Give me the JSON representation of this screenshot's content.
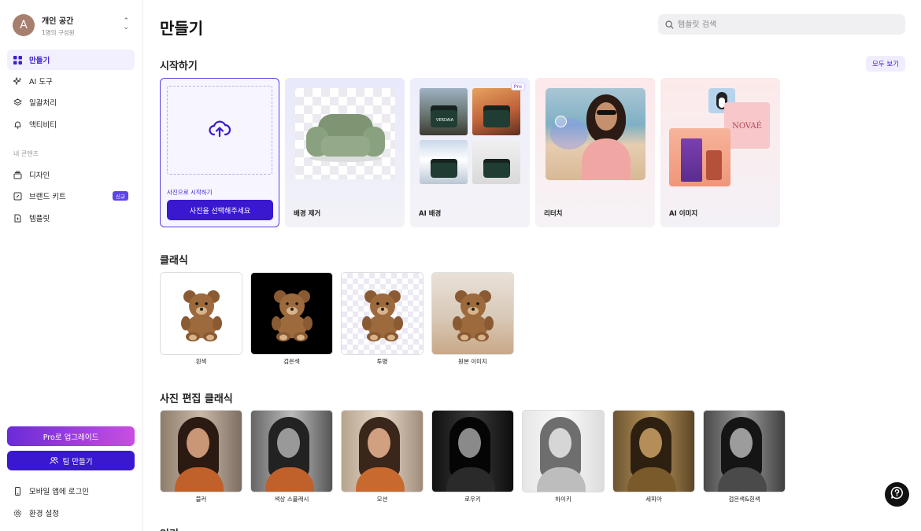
{
  "workspace": {
    "avatar_letter": "A",
    "name": "개인 공간",
    "members": "1명의 구성원"
  },
  "sidebar": {
    "items": [
      {
        "label": "만들기",
        "icon": "grid-icon"
      },
      {
        "label": "AI 도구",
        "icon": "sparkle-icon"
      },
      {
        "label": "일괄처리",
        "icon": "layers-icon"
      },
      {
        "label": "액티비티",
        "icon": "bell-icon"
      }
    ],
    "section_label": "내 콘텐츠",
    "content_items": [
      {
        "label": "디자인",
        "icon": "stack-icon"
      },
      {
        "label": "브랜드 키트",
        "icon": "brand-kit-icon",
        "badge": "신규"
      },
      {
        "label": "템플릿",
        "icon": "template-icon"
      }
    ],
    "pro_button": "Pro로 업그레이드",
    "team_button": "팀 만들기",
    "footer": [
      {
        "label": "모바일 앱에 로그인",
        "icon": "phone-icon"
      },
      {
        "label": "환경 설정",
        "icon": "gear-icon"
      }
    ]
  },
  "header": {
    "title": "만들기",
    "search_placeholder": "템플릿 검색"
  },
  "start": {
    "title": "시작하기",
    "see_all": "모두 보기",
    "upload_hint": "사진으로 시작하기",
    "upload_button": "사진을 선택해주세요",
    "cards": [
      {
        "label": "배경 제거"
      },
      {
        "label": "AI 배경",
        "tag": "Pro"
      },
      {
        "label": "리터치"
      },
      {
        "label": "AI 이미지"
      }
    ],
    "brand_text": "NOVAÉ",
    "product_text": "VERDAIA"
  },
  "classic": {
    "title": "클래식",
    "items": [
      "흰색",
      "검은색",
      "투명",
      "원본 이미지"
    ]
  },
  "photo_classic": {
    "title": "사진 편집 클래식",
    "items": [
      "블러",
      "색상 스플래시",
      "모션",
      "로우키",
      "하이키",
      "세피아",
      "검은색&흰색"
    ]
  },
  "next_section": {
    "title": "인기"
  },
  "colors": {
    "accent": "#3a18d0",
    "active_bg": "#f2efff"
  }
}
